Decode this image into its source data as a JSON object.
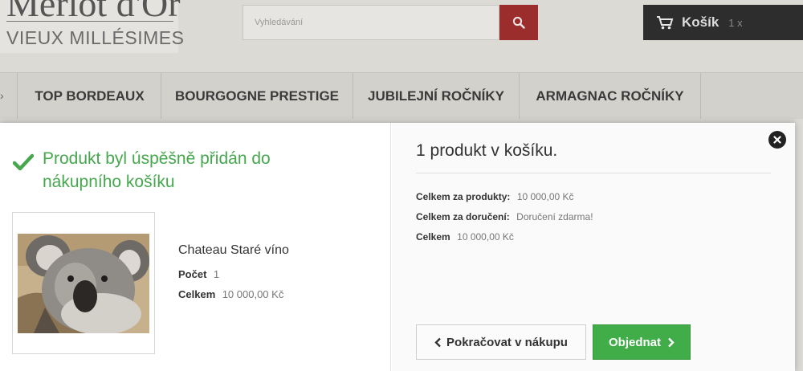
{
  "header": {
    "logo_title": "Merlot d'Or",
    "logo_subtitle": "VIEUX MILLÉSIMES",
    "search_placeholder": "Vyhledávání",
    "cart_label": "Košík",
    "cart_count": "1 x"
  },
  "nav": {
    "items": [
      {
        "label": "TOP BORDEAUX"
      },
      {
        "label": "BOURGOGNE PRESTIGE"
      },
      {
        "label": "JUBILEJNÍ ROČNÍKY"
      },
      {
        "label": "ARMAGNAC ROČNÍKY"
      }
    ]
  },
  "modal": {
    "success_message": "Produkt byl úspěšně přidán do nákupního košíku",
    "product": {
      "name": "Chateau Staré víno",
      "qty_label": "Počet",
      "qty_value": "1",
      "total_label": "Celkem",
      "total_value": "10 000,00 Kč"
    },
    "cart": {
      "heading": "1 produkt v košíku.",
      "products_label": "Celkem za produkty:",
      "products_value": "10 000,00 Kč",
      "shipping_label": "Celkem za doručení:",
      "shipping_value": "Doručení zdarma!",
      "total_label": "Celkem",
      "total_value": "10 000,00 Kč"
    },
    "continue_label": "Pokračovat v nákupu",
    "order_label": "Objednat"
  },
  "colors": {
    "success": "#46a74e",
    "order_button": "#40ad48",
    "search_button": "#9b2d2d",
    "cart_box": "#2d2d2d"
  },
  "icons": [
    "search-icon",
    "cart-icon",
    "check-icon",
    "close-icon",
    "chevron-left-icon",
    "chevron-right-icon"
  ]
}
